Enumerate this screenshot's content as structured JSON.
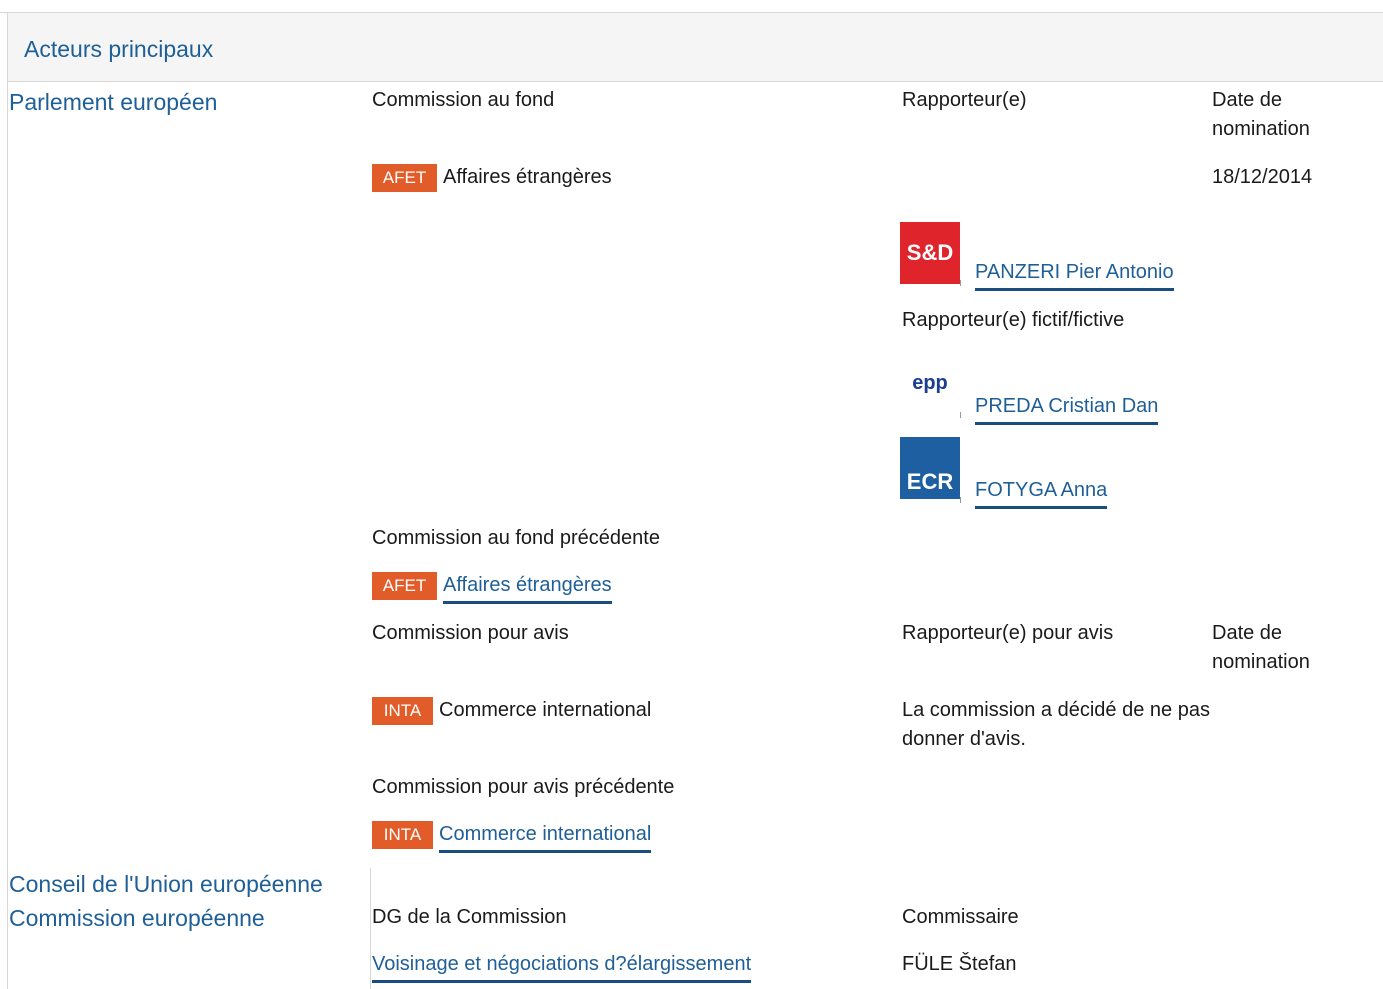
{
  "header": {
    "title": "Acteurs principaux"
  },
  "sections": {
    "parlement": "Parlement européen",
    "conseil": "Conseil de l'Union européenne",
    "commission": "Commission européenne"
  },
  "parliament": {
    "lead_committee_label": "Commission au fond",
    "rapporteur_label": "Rapporteur(e)",
    "appointment_label": "Date de nomination",
    "lead_committee": {
      "code": "AFET",
      "name": "Affaires étrangères",
      "date": "18/12/2014"
    },
    "rapporteur": {
      "party": "S&D",
      "name": "PANZERI Pier Antonio"
    },
    "shadow_label": "Rapporteur(e) fictif/fictive",
    "shadows": [
      {
        "party": "epp",
        "name": "PREDA Cristian Dan"
      },
      {
        "party": "ECR",
        "name": "FOTYGA Anna"
      }
    ],
    "prev_lead_label": "Commission au fond précédente",
    "prev_lead": {
      "code": "AFET",
      "name": "Affaires étrangères"
    },
    "opinion_label": "Commission pour avis",
    "opinion_rapporteur_label": "Rapporteur(e) pour avis",
    "opinion_appointment_label": "Date de nomination",
    "opinion_committee": {
      "code": "INTA",
      "name": "Commerce international",
      "note": "La commission a décidé de ne pas donner d'avis."
    },
    "prev_opinion_label": "Commission pour avis précédente",
    "prev_opinion": {
      "code": "INTA",
      "name": "Commerce international"
    }
  },
  "commission": {
    "dg_label": "DG de la Commission",
    "commissioner_label": "Commissaire",
    "dg": "Voisinage et négociations d?élargissement",
    "commissioner": "FÜLE Štefan"
  },
  "colors": {
    "accent": "#1f5f97",
    "badge": "#e15c29"
  }
}
